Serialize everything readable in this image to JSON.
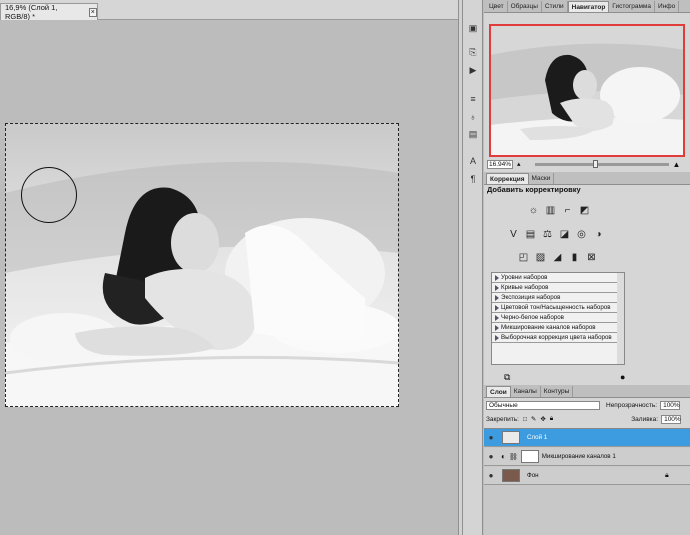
{
  "document": {
    "tab_title": "16,9% (Слой 1, RGB/8) *",
    "close_glyph": "×"
  },
  "tool_strip": {
    "icons": [
      "cube-icon",
      "history-icon",
      "actions-icon",
      "brush-preset-icon",
      "clone-source-icon",
      "tool-presets-icon",
      "character-icon",
      "paragraph-icon"
    ]
  },
  "top_panel": {
    "tabs": [
      "Цвет",
      "Образцы",
      "Стили",
      "Навигатор",
      "Гистограмма",
      "Инфо"
    ],
    "active_tab": "Навигатор",
    "zoom_value": "16.94%"
  },
  "adjustments": {
    "tabs": [
      "Коррекция",
      "Маски"
    ],
    "active_tab": "Коррекция",
    "title": "Добавить корректировку",
    "presets": [
      "Уровни наборов",
      "Кривые наборов",
      "Экспозиция наборов",
      "Цветовой тон/Насыщенность наборов",
      "Черно-белое наборов",
      "Микширование каналов наборов",
      "Выборочная коррекция цвета наборов"
    ]
  },
  "layers": {
    "tabs": [
      "Слои",
      "Каналы",
      "Контуры"
    ],
    "active_tab": "Слои",
    "blend_mode": "Обычные",
    "opacity_label": "Непрозрачность:",
    "opacity_value": "100%",
    "lock_label": "Закрепить:",
    "fill_label": "Заливка:",
    "fill_value": "100%",
    "items": [
      {
        "name": "Слой 1",
        "selected": true
      },
      {
        "name": "Микширование каналов 1",
        "selected": false
      },
      {
        "name": "Фон",
        "selected": false
      }
    ]
  },
  "colors": {
    "selection_highlight": "#3d9cdf",
    "navigator_frame": "#e03c3c"
  }
}
